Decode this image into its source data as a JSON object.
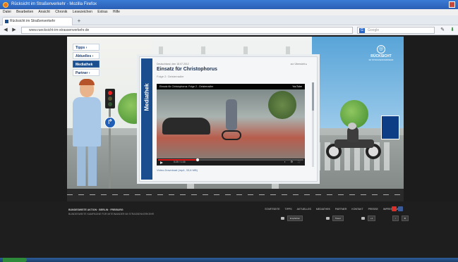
{
  "window": {
    "title": "Rücksicht im Straßenverkehr - Mozilla Firefox"
  },
  "menu": {
    "items": [
      "Datei",
      "Bearbeiten",
      "Ansicht",
      "Chronik",
      "Lesezeichen",
      "Extras",
      "Hilfe"
    ]
  },
  "tabs": [
    {
      "label": "Rücksicht im Straßenverkehr"
    }
  ],
  "nav": {
    "url": "www.ruecksicht-im-strassenverkehr.de",
    "search_placeholder": "Google"
  },
  "site": {
    "side_nav": [
      {
        "label": "Tipps",
        "style": "light"
      },
      {
        "label": "Aktuelles",
        "style": "light"
      },
      {
        "label": "Mediathek",
        "style": "dark"
      },
      {
        "label": "Partner",
        "style": "light"
      }
    ],
    "logo": {
      "text": "RÜCKSICHT",
      "sub": "IM STRASSENVERKEHR"
    },
    "billboard": {
      "section": "Mediathek",
      "date": "Deutschland, den 18.07.2012",
      "back_link": "zur Übersicht",
      "title": "Einsatz für Christophorus",
      "subtitle": "Folge 2: Geisterradler",
      "video_title": "Einsatz für Christophorus: Folge 2 - Geisterradler",
      "video_brand": "YouTube",
      "video_time": "0:20 / 1:16",
      "video_progress": 0.27,
      "download": "Video-Download (mp4, 33,8 MB)"
    },
    "footer": {
      "org_line1": "BUNDESWEITE AKTION · BERLIN · FREIBURG",
      "org_line2": "BUNDESWEITE KAMPAGNE FÜR MITEINANDER IM STRASSENVERKEHR",
      "links": [
        "STARTSEITE",
        "TIPPS",
        "AKTUELLES",
        "MEDIATHEK",
        "PARTNER",
        "KONTAKT",
        "PRESSE",
        "IMPRESSUM"
      ],
      "share_buttons": [
        "Empfehlen",
        "Tweet",
        "+1"
      ],
      "colors": {
        "youtube": "#d9302c",
        "facebook": "#3b5b98"
      }
    }
  },
  "colors": {
    "brand_blue": "#1b4e8f",
    "titlebar": "#2a5fb5"
  }
}
